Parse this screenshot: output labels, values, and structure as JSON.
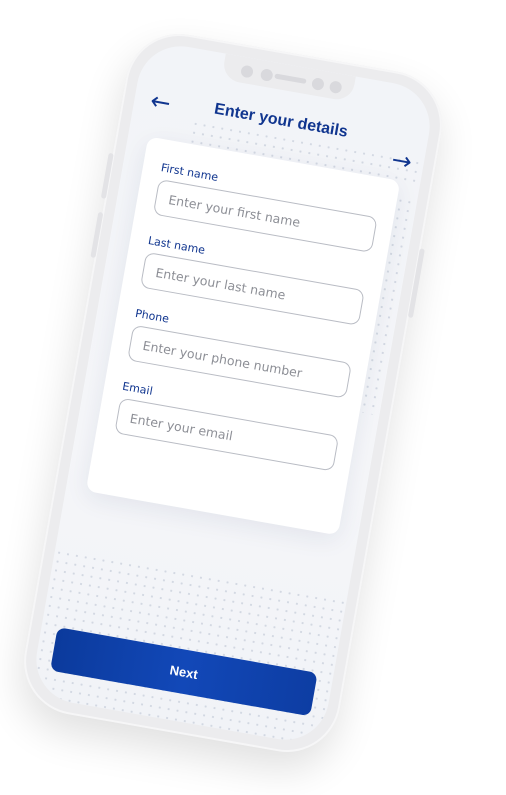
{
  "header": {
    "back_icon": "arrow-left-icon",
    "title": "Enter your details",
    "forward_icon": "arrow-right-icon"
  },
  "form": {
    "fields": [
      {
        "label": "First name",
        "placeholder": "Enter your first name",
        "value": ""
      },
      {
        "label": "Last name",
        "placeholder": "Enter your last name",
        "value": ""
      },
      {
        "label": "Phone",
        "placeholder": "Enter your phone number",
        "value": ""
      },
      {
        "label": "Email",
        "placeholder": "Enter your email",
        "value": ""
      }
    ]
  },
  "footer": {
    "next_label": "Next"
  },
  "colors": {
    "accent": "#10358F",
    "button": "#0B3A9C",
    "background": "#F2F4F8"
  }
}
